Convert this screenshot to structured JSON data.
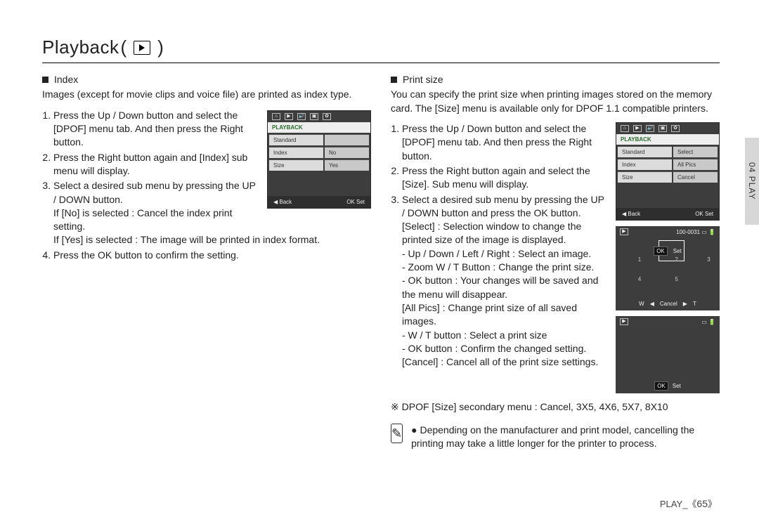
{
  "header": {
    "title": "Playback"
  },
  "left": {
    "section_title": "Index",
    "intro": "Images (except for movie clips and voice file) are printed as index type.",
    "steps": {
      "s1": "Press the Up / Down button and select the [DPOF] menu tab. And then press the Right button.",
      "s2": "Press the Right button again and [Index] sub menu will display.",
      "s3": "Select a desired sub menu by pressing the UP / DOWN button.",
      "s3_no": "If [No] is selected      : Cancel the index print setting.",
      "s3_yes": "If [Yes] is selected     : The image will be printed in index format.",
      "s4": "Press the OK button to confirm the setting."
    },
    "lcd": {
      "title": "PLAYBACK",
      "rows": [
        {
          "label": "Standard",
          "value": ""
        },
        {
          "label": "Index",
          "value": "No"
        },
        {
          "label": "Size",
          "value": "Yes"
        }
      ],
      "back": "Back",
      "ok": "OK",
      "set": "Set"
    }
  },
  "right": {
    "section_title": "Print size",
    "intro": "You can specify the print size when printing images stored on the memory card. The [Size] menu is available only for DPOF 1.1 compatible printers.",
    "steps": {
      "s1": "Press the Up / Down button and select the [DPOF] menu tab. And then press the Right button.",
      "s2": "Press the Right button again and select the [Size]. Sub menu will display.",
      "s3": "Select a desired sub menu by pressing the UP / DOWN button and press the OK button.",
      "select_head": "[Select] : Selection window to change the printed size of the image is displayed.",
      "b1": "- Up / Down / Left / Right : Select an image.",
      "b2": "- Zoom W / T Button : Change the print size.",
      "b3": "- OK button : Your changes will be saved and the menu will disappear.",
      "allpics": "[All Pics] : Change print size of all saved images.",
      "b4": "- W / T button : Select a print size",
      "b5": "- OK button : Confirm the changed setting.",
      "cancel": "[Cancel] : Cancel all of the print size settings."
    },
    "lcd1": {
      "title": "PLAYBACK",
      "rows": [
        {
          "label": "Standard",
          "value": "Select"
        },
        {
          "label": "Index",
          "value": "All Pics"
        },
        {
          "label": "Size",
          "value": "Cancel"
        }
      ],
      "back": "Back",
      "ok": "OK",
      "set": "Set"
    },
    "lcd2": {
      "counter": "100-0031",
      "w": "W",
      "cancel": "Cancel",
      "t": "T",
      "ok": "OK",
      "set": "Set",
      "n1": "1",
      "n2": "2",
      "n3": "3",
      "n4": "4",
      "n5": "5"
    },
    "lcd3": {
      "ok": "OK",
      "set": "Set"
    },
    "secondary": "※ DPOF [Size] secondary menu : Cancel, 3X5, 4X6, 5X7, 8X10",
    "note": "Depending on the manufacturer and print model, cancelling the printing may take a little longer for the printer to process."
  },
  "sidetab": "04 PLAY",
  "footer": {
    "label": "PLAY_",
    "page": "65"
  }
}
